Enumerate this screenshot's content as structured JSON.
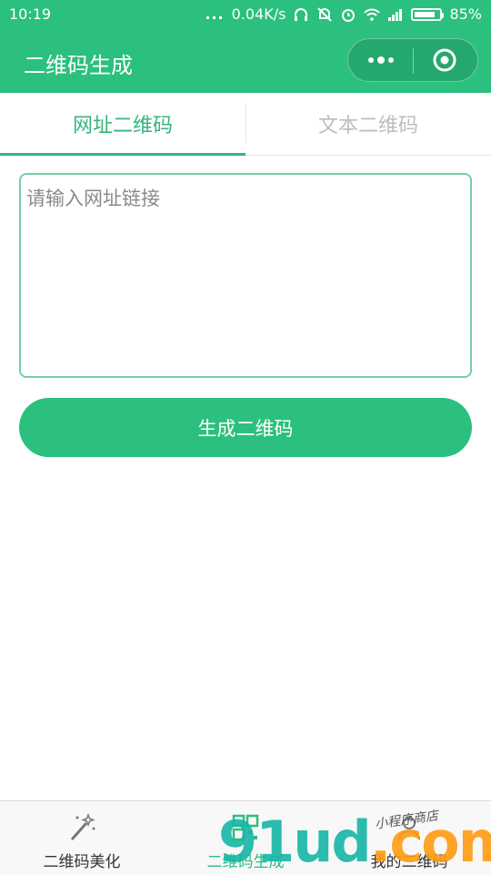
{
  "status_bar": {
    "time": "10:19",
    "dots": "...",
    "net_speed": "0.04K/s",
    "battery_text": "85%",
    "battery_level": 0.85
  },
  "nav": {
    "title": "二维码生成"
  },
  "tabs": [
    {
      "label": "网址二维码",
      "active": true
    },
    {
      "label": "文本二维码",
      "active": false
    }
  ],
  "input": {
    "placeholder": "请输入网址链接",
    "value": ""
  },
  "generate_button": {
    "label": "生成二维码"
  },
  "tab_bar": {
    "items": [
      {
        "label": "二维码美化",
        "icon": "magic-wand-icon"
      },
      {
        "label": "二维码生成",
        "icon": "qr-code-icon",
        "active": true
      },
      {
        "label": "我的二维码",
        "icon": "user-icon"
      }
    ]
  },
  "watermark": {
    "brand_a": "91ud",
    "brand_b": ".com",
    "tagline": "小程序商店"
  },
  "colors": {
    "primary": "#2bc07d",
    "tab_active": "#36b57c",
    "input_border": "#74cfa1"
  }
}
